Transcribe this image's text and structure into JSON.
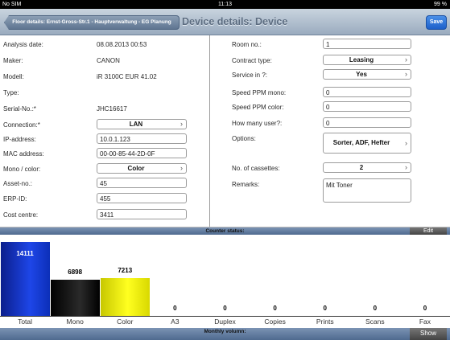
{
  "status_bar": {
    "carrier": "No SIM",
    "time": "11:13",
    "battery": "99 %"
  },
  "nav": {
    "back_label": "Floor details: Ernst-Gross-Str.1 - Hauptverwaltung - EG Planung",
    "title": "Device details: Device",
    "save_label": "Save"
  },
  "left_fields": {
    "analysis_date": {
      "label": "Analysis date:",
      "value": "08.08.2013 00:53"
    },
    "maker": {
      "label": "Maker:",
      "value": "CANON"
    },
    "modell": {
      "label": "Modell:",
      "value": "iR 3100C EUR 41.02"
    },
    "type": {
      "label": "Type:",
      "value": ""
    },
    "serial": {
      "label": "Serial-No.:*",
      "value": "JHC16617"
    },
    "connection": {
      "label": "Connection:*",
      "value": "LAN"
    },
    "ip": {
      "label": "IP-address:",
      "value": "10.0.1.123"
    },
    "mac": {
      "label": "MAC address:",
      "value": "00-00-85-44-2D-0F"
    },
    "mono_color": {
      "label": "Mono / color:",
      "value": "Color"
    },
    "asset": {
      "label": "Asset-no.:",
      "value": "45"
    },
    "erp": {
      "label": "ERP-ID:",
      "value": "455"
    },
    "cost_centre": {
      "label": "Cost centre:",
      "value": "3411"
    }
  },
  "right_fields": {
    "room": {
      "label": "Room no.:",
      "value": "1"
    },
    "contract": {
      "label": "Contract type:",
      "value": "Leasing"
    },
    "service": {
      "label": "Service in ?:",
      "value": "Yes"
    },
    "ppm_mono": {
      "label": "Speed PPM mono:",
      "value": "0"
    },
    "ppm_color": {
      "label": "Speed PPM color:",
      "value": "0"
    },
    "users": {
      "label": "How many user?:",
      "value": "0"
    },
    "options": {
      "label": "Options:",
      "value": "Sorter, ADF, Hefter"
    },
    "cassettes": {
      "label": "No. of cassettes:",
      "value": "2"
    },
    "remarks": {
      "label": "Remarks:",
      "value": "Mit Toner"
    }
  },
  "counter": {
    "header": "Counter status:",
    "edit_label": "Edit"
  },
  "monthly": {
    "header": "Monthly volumn:",
    "show_label": "Show"
  },
  "chart_data": {
    "type": "bar",
    "categories": [
      "Total",
      "Mono",
      "Color",
      "A3",
      "Duplex",
      "Copies",
      "Prints",
      "Scans",
      "Fax"
    ],
    "values": [
      14111,
      6898,
      7213,
      0,
      0,
      0,
      0,
      0,
      0
    ],
    "value_labels": [
      "14111",
      "6898",
      "7213",
      "0",
      "0",
      "0",
      "0",
      "0",
      "0"
    ],
    "colors": [
      "#1e46e8",
      "#000000",
      "#ffff20",
      "",
      "",
      "",
      "",
      "",
      ""
    ],
    "ylim": [
      0,
      15500
    ]
  }
}
